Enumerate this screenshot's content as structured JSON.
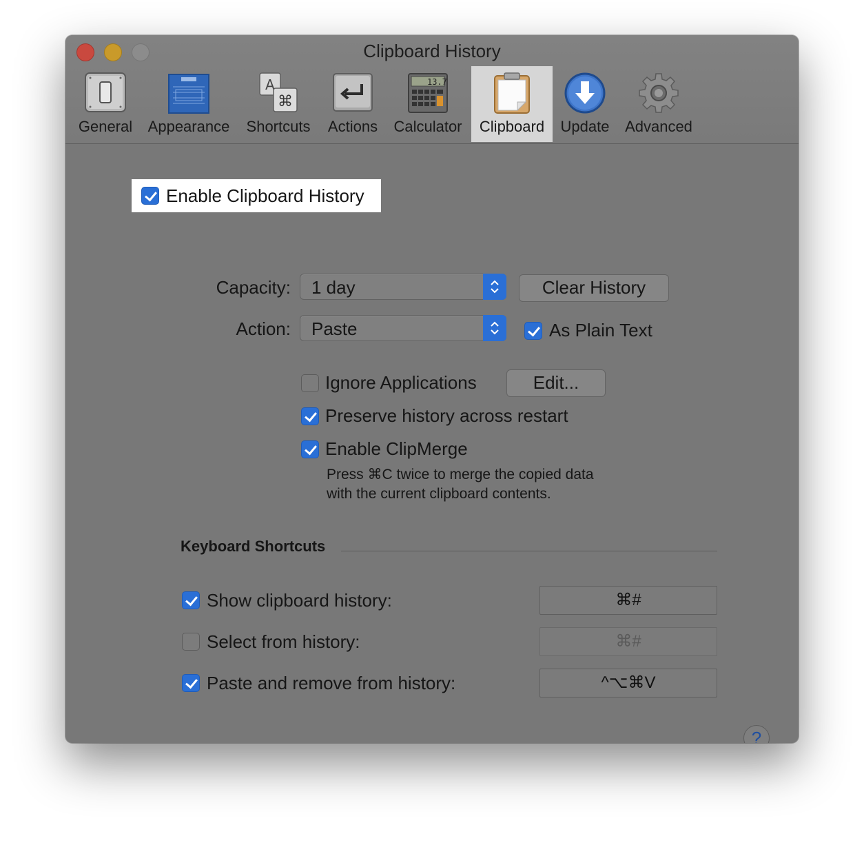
{
  "window": {
    "title": "Clipboard History"
  },
  "toolbar": {
    "items": [
      {
        "label": "General",
        "icon": "switch-icon"
      },
      {
        "label": "Appearance",
        "icon": "blueprint-icon"
      },
      {
        "label": "Shortcuts",
        "icon": "keyboard-shortcut-icon"
      },
      {
        "label": "Actions",
        "icon": "return-arrow-icon"
      },
      {
        "label": "Calculator",
        "icon": "calculator-icon"
      },
      {
        "label": "Clipboard",
        "icon": "clipboard-icon",
        "selected": true
      },
      {
        "label": "Update",
        "icon": "download-arrow-icon"
      },
      {
        "label": "Advanced",
        "icon": "gear-icon"
      }
    ]
  },
  "clipboard": {
    "enable_label": "Enable Clipboard History",
    "enable_checked": true,
    "capacity_label": "Capacity:",
    "capacity_value": "1 day",
    "clear_history_label": "Clear History",
    "action_label": "Action:",
    "action_value": "Paste",
    "plain_text_label": "As Plain Text",
    "plain_text_checked": true,
    "ignore_apps_label": "Ignore Applications",
    "ignore_apps_checked": false,
    "edit_label": "Edit...",
    "preserve_label": "Preserve history across restart",
    "preserve_checked": true,
    "clipmerge_label": "Enable ClipMerge",
    "clipmerge_checked": true,
    "clipmerge_desc_1": "Press ⌘C twice to merge the copied data",
    "clipmerge_desc_2": "with the current clipboard contents."
  },
  "shortcuts": {
    "section_title": "Keyboard Shortcuts",
    "rows": [
      {
        "label": "Show clipboard history:",
        "checked": true,
        "keys": "⌘#"
      },
      {
        "label": "Select from history:",
        "checked": false,
        "keys": "⌘#"
      },
      {
        "label": "Paste and remove from history:",
        "checked": true,
        "keys": "^⌥⌘V"
      }
    ]
  },
  "help": {
    "label": "?"
  },
  "colors": {
    "accent": "#2a6fd6",
    "window_bg": "#787878",
    "selected_tab_bg": "#d6d6d6"
  }
}
